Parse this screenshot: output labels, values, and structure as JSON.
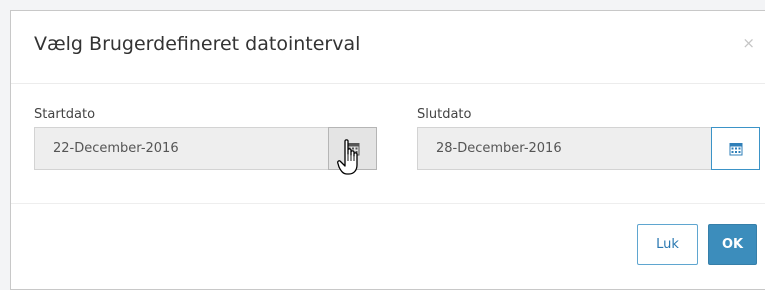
{
  "dialog": {
    "title": "Vælg Brugerdefineret datointerval",
    "close_symbol": "×"
  },
  "start": {
    "label": "Startdato",
    "value": "22-December-2016",
    "icon": "calendar-icon"
  },
  "end": {
    "label": "Slutdato",
    "value": "28-December-2016",
    "icon": "calendar-icon"
  },
  "footer": {
    "close_label": "Luk",
    "ok_label": "OK"
  },
  "colors": {
    "accent": "#3c8dbc",
    "calendar_icon_start": "#555555",
    "calendar_icon_end": "#2f7fb8"
  }
}
